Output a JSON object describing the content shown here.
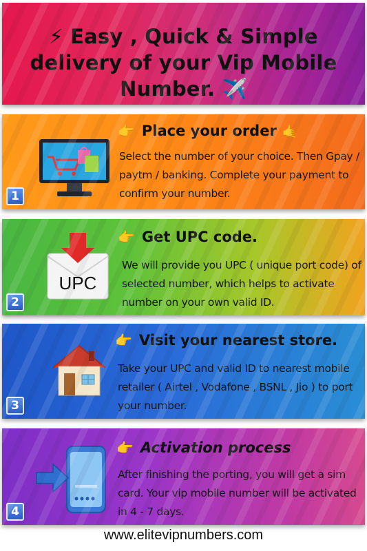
{
  "hero": {
    "line1": "⚡ Easy , Quick & Simple",
    "line2": "delivery of your Vip Mobile",
    "line3": "Number. ✈️"
  },
  "steps": [
    {
      "number": "1",
      "pointer": "👉",
      "heading": "Place your order",
      "heading_extra": "🤙",
      "text": "Select the number of your choice. Then Gpay / paytm / banking. Complete your payment to confirm your number.",
      "icon": "shopping-monitor-icon"
    },
    {
      "number": "2",
      "pointer": "👉",
      "heading": "Get UPC code.",
      "text": "We will provide you UPC ( unique port code) of selected number, which helps to activate number on your own valid ID.",
      "icon": "upc-envelope-icon",
      "icon_label": "UPC"
    },
    {
      "number": "3",
      "pointer": "👉",
      "heading": "Visit your nearest store.",
      "text": "Take your UPC and valid ID to nearest mobile retailer ( Airtel , Vodafone , BSNL , Jio ) to port your number.",
      "icon": "house-icon"
    },
    {
      "number": "4",
      "pointer": "👉",
      "heading": "Activation process",
      "text": "After finishing the porting, you will get a sim card. Your vip mobile number will be activated in 4 - 7 days.",
      "icon": "phone-arrow-icon"
    }
  ],
  "footer": {
    "website": "www.elitevipnumbers.com"
  },
  "colors": {
    "hero": "#e2275c",
    "step1": "#ff8a17",
    "step2": "#5fc23a",
    "step3": "#2a6ad8",
    "step4": "#9a36c8"
  }
}
